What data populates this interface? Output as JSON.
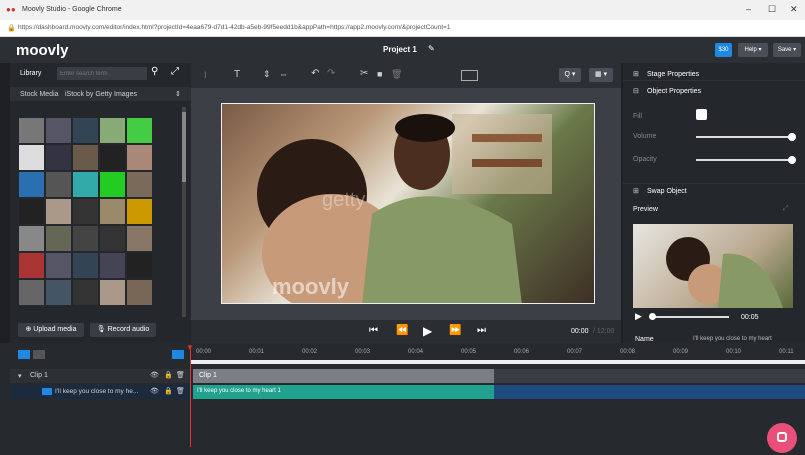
{
  "browser": {
    "title": "Moovly Studio - Google Chrome",
    "url": "https://dashboard.moovly.com/editor/index.html?projectId=4eaa679-d7d1-42db-a5eb-99f5eedd1b&appPath=https://app2.moovly.com/&projectCount=1",
    "controls": [
      "–",
      "☐",
      "✕"
    ]
  },
  "app": {
    "logo": "moovly",
    "project_title": "Project 1",
    "save_label": "$30",
    "help_label": "Help ▾",
    "save_menu": "Save ▾"
  },
  "library": {
    "tab": "Library",
    "search_placeholder": "Enter search term",
    "source": "Stock Media",
    "breadcrumb": "iStock by Getty Images",
    "upload_label": "Upload media",
    "record_label": "Record audio",
    "thumb_colors": [
      "#777",
      "#556",
      "#345",
      "#8a7",
      "#4c4",
      "#ddd",
      "#334",
      "#6a5a4a",
      "#222",
      "#a87",
      "#2a6fb0",
      "#555",
      "#3aa",
      "#2c2",
      "#7a6a5a",
      "#222",
      "#a98",
      "#333",
      "#9a8a6a",
      "#c90",
      "#888",
      "#665",
      "#444",
      "#333",
      "#876",
      "#a33",
      "#556",
      "#345",
      "#445",
      "#222",
      "#666",
      "#456",
      "#333",
      "#a98",
      "#765"
    ]
  },
  "toolbar": {
    "zoom_label": "Q ▾",
    "grid_label": "▦ ▾"
  },
  "stage": {
    "watermark": "moovly",
    "getty": "getty"
  },
  "playbar": {
    "time": "00:00",
    "duration": "12:00"
  },
  "props": {
    "stage_props": "Stage Properties",
    "object_props": "Object Properties",
    "fill_label": "Fill",
    "volume_label": "Volume",
    "opacity_label": "Opacity",
    "swap_label": "Swap Object",
    "preview_label": "Preview",
    "preview_time": "00:05",
    "name_label": "Name",
    "name_value": "I'll keep you close to my heart",
    "volume": 1,
    "opacity": 1
  },
  "timeline": {
    "ticks": [
      "00:00",
      "00:01",
      "00:02",
      "00:03",
      "00:04",
      "00:05",
      "00:06",
      "00:07",
      "00:08",
      "00:09",
      "00:10",
      "00:11"
    ],
    "clip_label": "Clip 1",
    "track_label": "I'll keep you close to my he...",
    "bar_clip": "Clip 1",
    "bar_video": "I'll keep you close to my heart 1"
  },
  "colors": {
    "accent": "#1e88e5",
    "teal": "#20a28e",
    "playhead": "#d33",
    "chat": "#e8507a"
  }
}
